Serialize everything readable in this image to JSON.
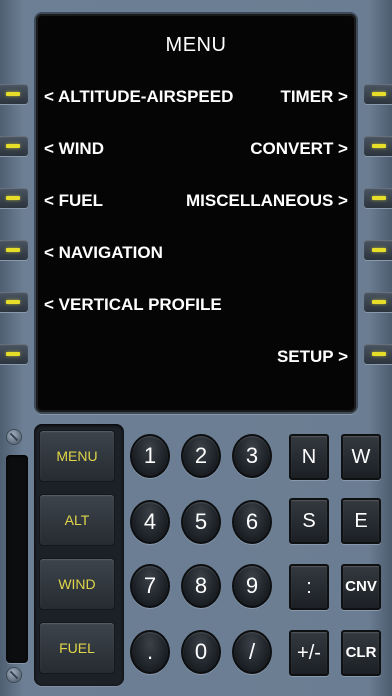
{
  "screen": {
    "title": "MENU",
    "left_lines": [
      "< ALTITUDE-AIRSPEED",
      "< WIND",
      "< FUEL",
      "< NAVIGATION",
      "< VERTICAL PROFILE"
    ],
    "right_lines": [
      "TIMER >",
      "CONVERT >",
      "MISCELLANEOUS >",
      "SETUP >"
    ]
  },
  "function_keys": [
    "MENU",
    "ALT",
    "WIND",
    "FUEL"
  ],
  "numeric_keys": [
    "1",
    "2",
    "3",
    "4",
    "5",
    "6",
    "7",
    "8",
    "9",
    ".",
    "0",
    "/"
  ],
  "right_keys": [
    "N",
    "W",
    "S",
    "E",
    ":",
    "CNV",
    "+/-",
    "CLR"
  ],
  "colors": {
    "screen_bg": "#050505",
    "indicator_yellow": "#e6de2a",
    "function_key_text": "#e0d54a",
    "panel": "#6b7d92"
  }
}
